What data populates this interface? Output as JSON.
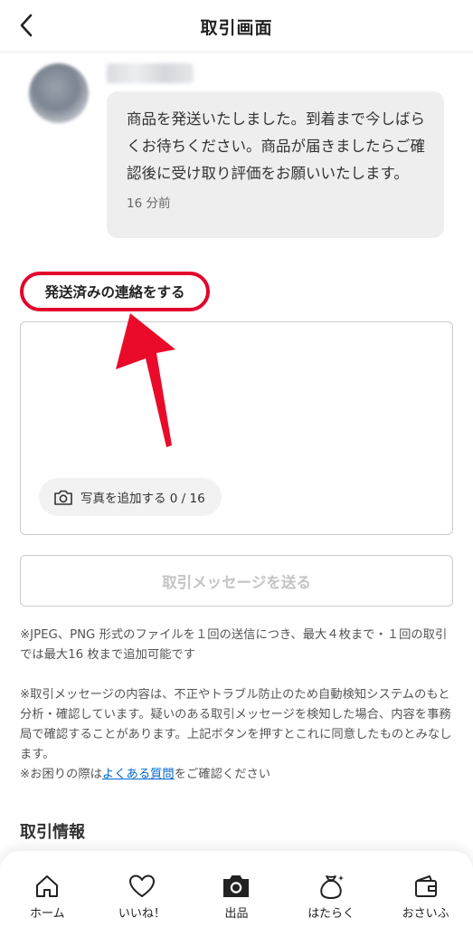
{
  "header": {
    "title": "取引画面"
  },
  "message": {
    "text": "商品を発送いたしました。到着まで今しばらくお待ちください。商品が届きましたらご確認後に受け取り評価をお願いいたします。",
    "time": "16 分前"
  },
  "compose": {
    "section_label": "発送済みの連絡をする",
    "add_photo_label": "写真を追加する 0 / 16",
    "send_label": "取引メッセージを送る"
  },
  "notes": {
    "file_note": "※JPEG、PNG 形式のファイルを１回の送信につき、最大４枚まで・１回の取引では最大16 枚まで追加可能です",
    "monitor_note": "※取引メッセージの内容は、不正やトラブル防止のため自動検知システムのもと分析・確認しています。疑いのある取引メッセージを検知した場合、内容を事務局で確認することがあります。上記ボタンを押すとこれに同意したものとみなします。",
    "help_prefix": "※お困りの際は",
    "help_link": "よくある質問",
    "help_suffix": "をご確認ください"
  },
  "info_heading": "取引情報",
  "tabbar": {
    "items": [
      {
        "label": "ホーム",
        "icon": "home-icon"
      },
      {
        "label": "いいね！",
        "icon": "heart-icon"
      },
      {
        "label": "出品",
        "icon": "camera-icon"
      },
      {
        "label": "はたらく",
        "icon": "money-bag-icon"
      },
      {
        "label": "おさいふ",
        "icon": "wallet-icon"
      }
    ]
  },
  "colors": {
    "highlight": "#e4002b",
    "link": "#0066cc",
    "bubble": "#eeeeee"
  }
}
